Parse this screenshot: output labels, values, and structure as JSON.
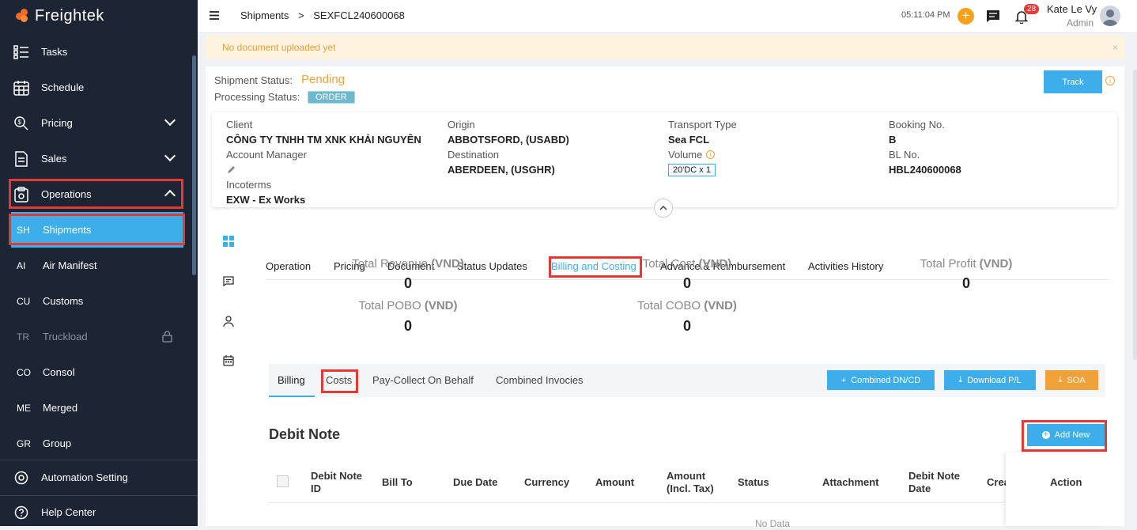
{
  "app": {
    "name": "Freightek"
  },
  "sidebar": {
    "items": [
      {
        "label": "Tasks"
      },
      {
        "label": "Schedule"
      },
      {
        "label": "Pricing"
      },
      {
        "label": "Sales"
      },
      {
        "label": "Operations"
      },
      {
        "label": "Automation Setting"
      },
      {
        "label": "Help Center"
      }
    ],
    "subitems": [
      {
        "abbr": "SH",
        "label": "Shipments"
      },
      {
        "abbr": "AI",
        "label": "Air Manifest"
      },
      {
        "abbr": "CU",
        "label": "Customs"
      },
      {
        "abbr": "TR",
        "label": "Truckload"
      },
      {
        "abbr": "CO",
        "label": "Consol"
      },
      {
        "abbr": "ME",
        "label": "Merged"
      },
      {
        "abbr": "GR",
        "label": "Group"
      }
    ]
  },
  "header": {
    "breadcrumb_root": "Shipments",
    "breadcrumb_sep": ">",
    "breadcrumb_current": "SEXFCL240600068",
    "time": "05:11:04 PM",
    "notif_count": "28",
    "user_name": "Kate Le Vy",
    "user_role": "Admin"
  },
  "alert": {
    "text": "No document uploaded yet",
    "close": "×"
  },
  "status": {
    "shipment_label": "Shipment Status:",
    "shipment_value": "Pending",
    "processing_label": "Processing Status:",
    "processing_value": "ORDER",
    "track_label": "Track"
  },
  "info": {
    "client_label": "Client",
    "client_value": "CÔNG TY TNHH TM XNK KHẢI NGUYÊN",
    "account_manager_label": "Account Manager",
    "incoterms_label": "Incoterms",
    "incoterms_value": "EXW - Ex Works",
    "origin_label": "Origin",
    "origin_value": "ABBOTSFORD, (USABD)",
    "destination_label": "Destination",
    "destination_value": "ABERDEEN, (USGHR)",
    "transport_label": "Transport Type",
    "transport_value": "Sea FCL",
    "volume_label": "Volume",
    "volume_value": "20'DC x 1",
    "booking_label": "Booking No.",
    "booking_value": "B",
    "bl_label": "BL No.",
    "bl_value": "HBL240600068"
  },
  "tabs": [
    "Operation",
    "Pricing",
    "Document",
    "Status Updates",
    "Billing and Costing",
    "Advance & Reimbursement",
    "Activities History"
  ],
  "totals": {
    "revenue_label": "Total Revenue ",
    "revenue_unit": "(VND)",
    "revenue_value": "0",
    "cost_label": "Total Cost ",
    "cost_unit": "(VND)",
    "cost_value": "0",
    "profit_label": "Total Profit ",
    "profit_unit": "(VND)",
    "profit_value": "0",
    "pobo_label": "Total POBO ",
    "pobo_unit": "(VND)",
    "pobo_value": "0",
    "cobo_label": "Total COBO ",
    "cobo_unit": "(VND)",
    "cobo_value": "0"
  },
  "subtabs": [
    "Billing",
    "Costs",
    "Pay-Collect On Behalf",
    "Combined Invocies"
  ],
  "actions": {
    "combined": "Combined DN/CD",
    "download": "Download P/L",
    "soa": "SOA",
    "add_new": "Add New"
  },
  "debit_note": {
    "title": "Debit Note",
    "columns": [
      "Debit Note ID",
      "Bill To",
      "Due Date",
      "Currency",
      "Amount",
      "Amount (Incl. Tax)",
      "Status",
      "Attachment",
      "Debit Note Date",
      "Crea",
      "Action"
    ],
    "empty_text": "No Data"
  },
  "colors": {
    "sidebar_bg": "#1d2433",
    "accent": "#3daee9",
    "orange": "#f0a23a",
    "highlight": "#e53935"
  }
}
